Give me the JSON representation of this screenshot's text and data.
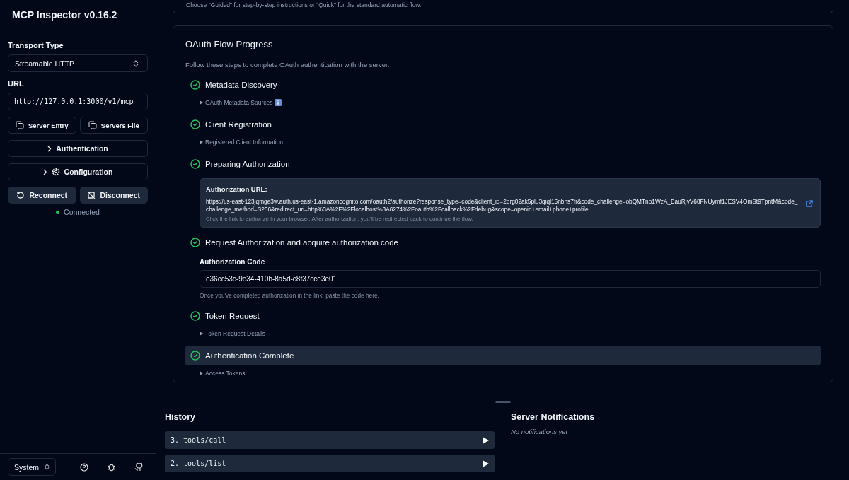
{
  "sidebar": {
    "title": "MCP Inspector v0.16.2",
    "transport_label": "Transport Type",
    "transport_value": "Streamable HTTP",
    "url_label": "URL",
    "url_value": "http://127.0.0.1:3000/v1/mcp",
    "copy_buttons": [
      "Server Entry",
      "Servers File"
    ],
    "expanders": [
      {
        "label": "Authentication",
        "kind": "plain"
      },
      {
        "label": "Configuration",
        "kind": "gear"
      }
    ],
    "actions": [
      {
        "label": "Reconnect",
        "kind": "reconnect"
      },
      {
        "label": "Disconnect",
        "kind": "disconnect"
      }
    ],
    "status": {
      "text": "Connected",
      "connected": true
    },
    "theme": "System"
  },
  "top_note": "Choose \"Guided\" for step-by-step instructions or \"Quick\" for the standard automatic flow.",
  "oauth": {
    "title": "OAuth Flow Progress",
    "subtitle": "Follow these steps to complete OAuth authentication with the server.",
    "steps": [
      {
        "title": "Metadata Discovery",
        "completed": true,
        "highlighted": false,
        "kind": "details",
        "details": "OAuth Metadata Sources",
        "info": true
      },
      {
        "title": "Client Registration",
        "completed": true,
        "highlighted": false,
        "kind": "details",
        "details": "Registered Client Information",
        "info": false
      },
      {
        "title": "Preparing Authorization",
        "completed": true,
        "highlighted": false,
        "kind": "auth_url",
        "label": "Authorization URL:",
        "url": "https://us-east-123jqmge3w.auth.us-east-1.amazoncognito.com/oauth2/authorize?response_type=code&client_id=2prg02ak5plu3qiql15nbns7fr&code_challenge=obQMTno1WzA_BauRjvV68FNUymf1JESV4OmSt9TpntM&code_challenge_method=S256&redirect_uri=http%3A%2F%2Flocalhost%3A6274%2Foauth%2Fcallback%2Fdebug&scope=openid+email+phone+profile",
        "hint": "Click the link to authorize in your browser. After authorization, you'll be redirected back to continue the flow."
      },
      {
        "title": "Request Authorization and acquire authorization code",
        "completed": true,
        "highlighted": false,
        "kind": "code_input",
        "label": "Authorization Code",
        "value": "e36cc53c-9e34-410b-8a5d-c8f37cce3e01",
        "hint": "Once you've completed authorization in the link, paste the code here."
      },
      {
        "title": "Token Request",
        "completed": true,
        "highlighted": false,
        "kind": "details",
        "details": "Token Request Details",
        "info": false
      },
      {
        "title": "Authentication Complete",
        "completed": true,
        "highlighted": true,
        "kind": "details",
        "details": "Access Tokens",
        "info": false
      }
    ]
  },
  "history": {
    "title": "History",
    "items": [
      "3. tools/call",
      "2. tools/list"
    ]
  },
  "notifications": {
    "title": "Server Notifications",
    "empty": "No notifications yet"
  }
}
